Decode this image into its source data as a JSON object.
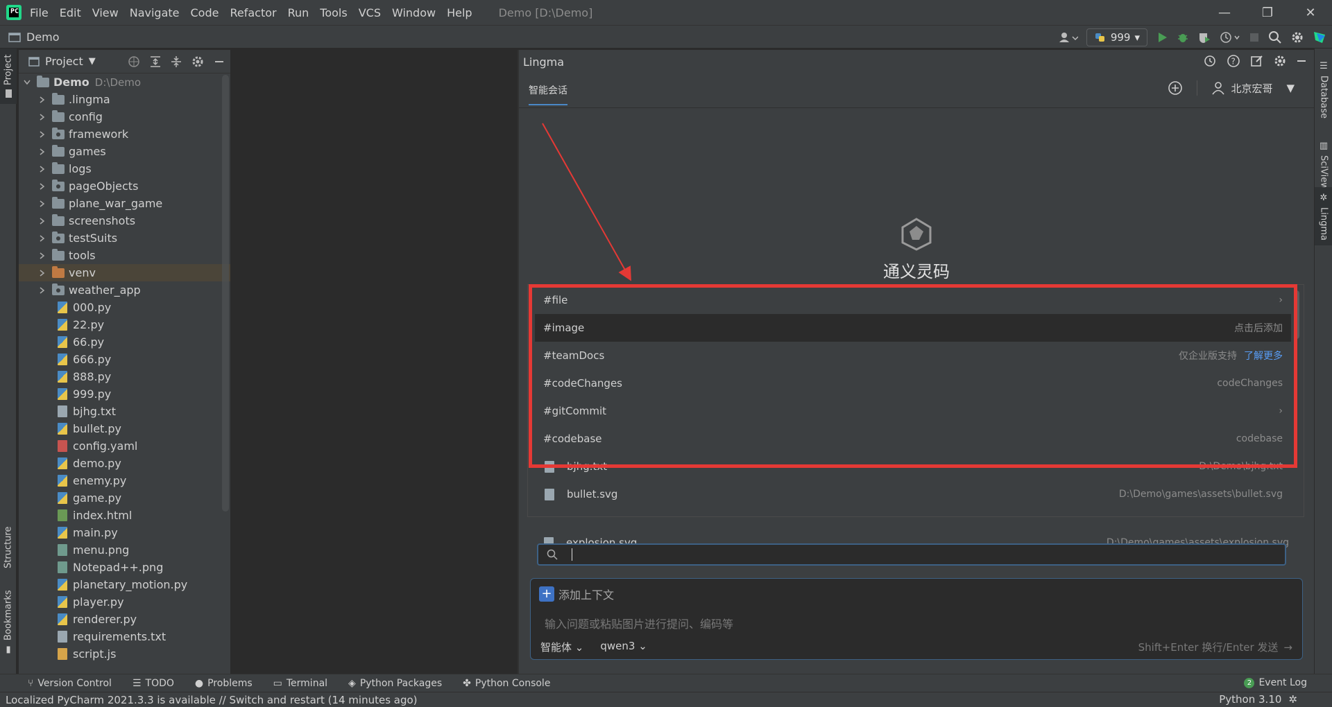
{
  "menubar": {
    "items": [
      "File",
      "Edit",
      "View",
      "Navigate",
      "Code",
      "Refactor",
      "Run",
      "Tools",
      "VCS",
      "Window",
      "Help"
    ],
    "title": "Demo [D:\\Demo]"
  },
  "navbar": {
    "project_name": "Demo",
    "run_config": "999"
  },
  "left_strip": {
    "project": "Project",
    "structure": "Structure",
    "bookmarks": "Bookmarks"
  },
  "right_strip": {
    "database": "Database",
    "sciview": "SciView",
    "lingma": "Lingma"
  },
  "project_panel": {
    "title": "Project",
    "root": {
      "name": "Demo",
      "path": "D:\\Demo"
    },
    "folders": [
      ".lingma",
      "config",
      "framework",
      "games",
      "logs",
      "pageObjects",
      "plane_war_game",
      "screenshots",
      "testSuits",
      "tools",
      "venv",
      "weather_app"
    ],
    "files": [
      "000.py",
      "22.py",
      "66.py",
      "666.py",
      "888.py",
      "999.py",
      "bjhg.txt",
      "bullet.py",
      "config.yaml",
      "demo.py",
      "enemy.py",
      "game.py",
      "index.html",
      "main.py",
      "menu.png",
      "Notepad++.png",
      "planetary_motion.py",
      "player.py",
      "renderer.py",
      "requirements.txt",
      "script.js"
    ]
  },
  "lingma": {
    "title": "Lingma",
    "tab": "智能会话",
    "user": "北京宏哥",
    "brand": "通义灵码",
    "popup_items": [
      {
        "label": "#file",
        "right": "",
        "link": ""
      },
      {
        "label": "#image",
        "right": "点击后添加",
        "link": ""
      },
      {
        "label": "#teamDocs",
        "right": "仅企业版支持",
        "link": "了解更多"
      },
      {
        "label": "#codeChanges",
        "right": "codeChanges",
        "link": ""
      },
      {
        "label": "#gitCommit",
        "right": "",
        "link": ""
      },
      {
        "label": "#codebase",
        "right": "codebase",
        "link": ""
      }
    ],
    "popup_files": [
      {
        "name": "bjhg.txt",
        "path": "D:\\Demo\\bjhg.txt"
      },
      {
        "name": "bullet.svg",
        "path": "D:\\Demo\\games\\assets\\bullet.svg"
      },
      {
        "name": "explosion.svg",
        "path": "D:\\Demo\\games\\assets\\explosion.svg"
      }
    ],
    "search_value": "",
    "add_context": "添加上下文",
    "placeholder": "输入问题或粘贴图片进行提问、编码等",
    "mode": "智能体",
    "model": "qwen3",
    "send_hint": "Shift+Enter 换行/Enter 发送"
  },
  "bottom_tools": [
    "Version Control",
    "TODO",
    "Problems",
    "Terminal",
    "Python Packages",
    "Python Console"
  ],
  "event_log": {
    "label": "Event Log",
    "count": "2"
  },
  "status": {
    "message": "Localized PyCharm 2021.3.3 is available // Switch and restart (14 minutes ago)",
    "interpreter": "Python 3.10"
  },
  "colors": {
    "accent": "#4a88c7",
    "highlight_box": "#e53935",
    "selection": "#4b4539"
  }
}
